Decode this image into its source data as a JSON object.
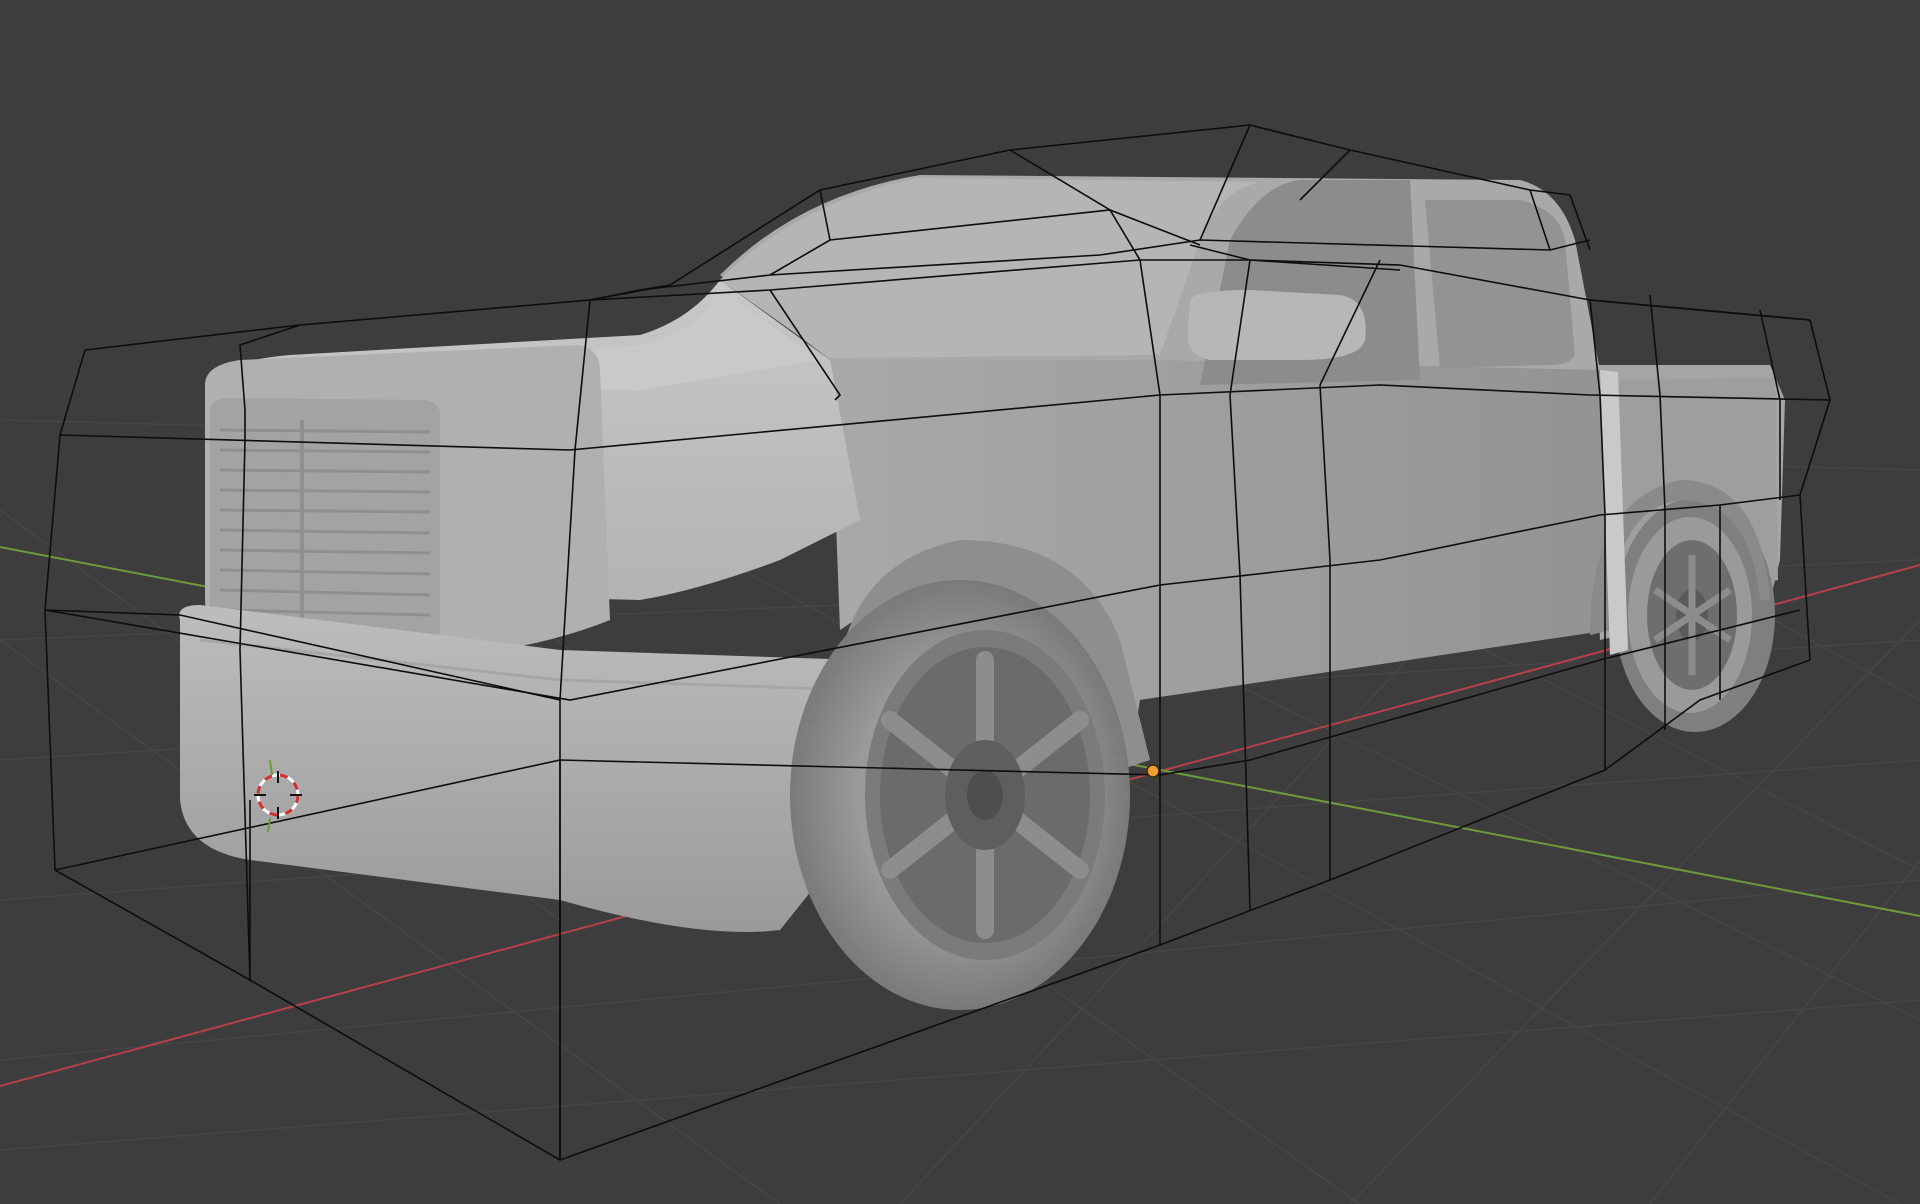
{
  "app": {
    "name": "3D viewport",
    "mode": "object-lattice"
  },
  "colors": {
    "background": "#3d3d3d",
    "grid_line": "#4a4a4a",
    "grid_line_minor": "#444444",
    "axis_x": "#b5404a",
    "axis_y": "#6f9a3a",
    "body_light": "#c4c4c4",
    "body_mid": "#a8a8a8",
    "body_dark": "#7e7e7e",
    "tire": "#8f8f8f",
    "rim": "#6e6e6e",
    "lattice": "#0d0d0d",
    "origin_point": "#f0a030",
    "cursor_red": "#d03030",
    "cursor_white": "#ffffff"
  },
  "icons": {
    "cursor": "3d-cursor-icon",
    "origin": "object-origin-dot"
  },
  "objects": [
    {
      "name": "pickup-truck-mesh",
      "type": "mesh"
    },
    {
      "name": "lattice-cage",
      "type": "lattice"
    }
  ]
}
